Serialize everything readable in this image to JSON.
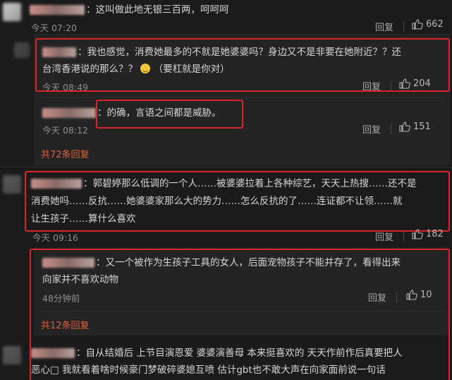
{
  "comments": [
    {
      "text_lines": [
        "：这叫做此地无银三百两，呵呵呵"
      ],
      "time": "今天 07:20",
      "reply_label": "回复",
      "likes": "662"
    },
    {
      "text_lines": [
        "：我也感觉，消费她最多的不就是她婆婆吗？身边又不是非要在她附近？？还",
        "台湾香港说的那么？？",
        "（要杠就是你对）"
      ],
      "time": "今天 08:49",
      "reply_label": "回复",
      "likes": "204"
    },
    {
      "text_lines": [
        "：的确，言语之间都是威胁。"
      ],
      "time": "今天 08:12",
      "reply_label": "回复",
      "likes": "151"
    },
    {
      "more_label": "共72条回复"
    },
    {
      "text_lines": [
        "：郭碧婷那么低调的一个人……被婆婆拉着上各种综艺，天天上热搜……还不是",
        "消费她吗……反抗……她婆婆家那么大的势力……怎么反抗的了……连证都不让领……就",
        "让生孩子……算什么喜欢"
      ],
      "time": "今天 09:16",
      "reply_label": "回复",
      "likes": "182"
    },
    {
      "text_lines": [
        "：又一个被作为生孩子工具的女人，后面宠物孩子不能并存了，看得出来",
        "向家并不喜欢动物"
      ],
      "time": "48分钟前",
      "reply_label": "回复",
      "likes": "10"
    },
    {
      "more_label": "共12条回复"
    },
    {
      "text_lines": [
        "：自从结婚后 上节目演恩爱 婆婆演善母 本来挺喜欢的 天天作前作后真要把人",
        "恶心□ 我就看着啥时候豪门梦破碎婆媳互喷 估计gbt也不敢大声在向家面前说一句话"
      ]
    }
  ],
  "colors": {
    "highlight_border": "#d8262a",
    "more_link": "#e0603a"
  }
}
